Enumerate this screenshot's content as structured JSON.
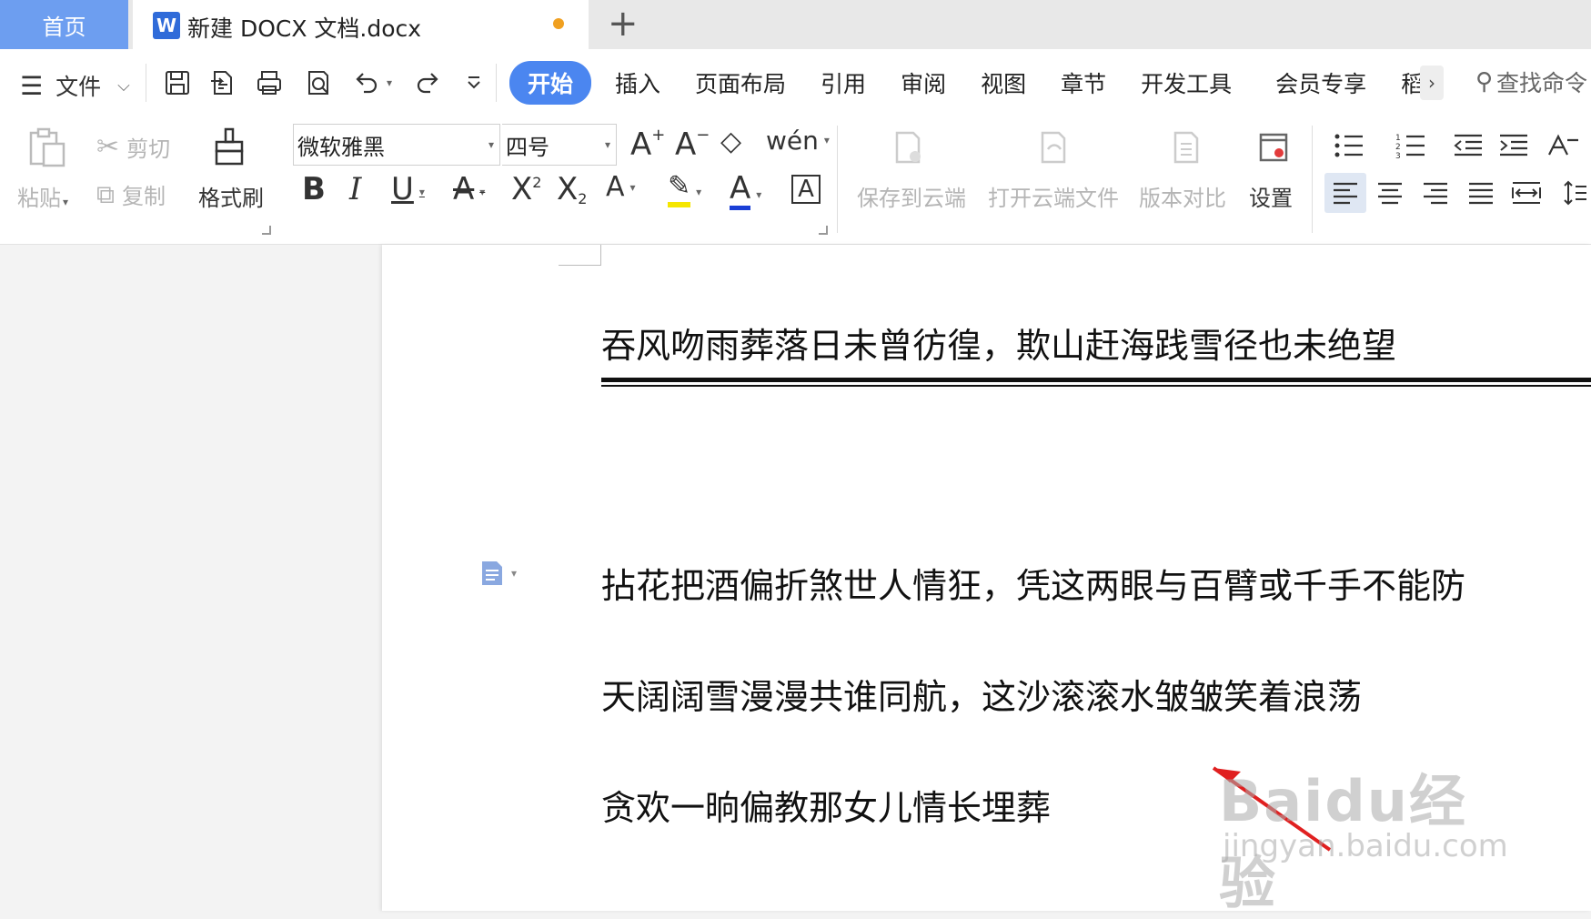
{
  "tabs": {
    "home_label": "首页",
    "doc_title": "新建 DOCX 文档.docx",
    "add_label": "+"
  },
  "menu": {
    "file_label": "文件",
    "tabs": [
      "开始",
      "插入",
      "页面布局",
      "引用",
      "审阅",
      "视图",
      "章节",
      "开发工具",
      "会员专享",
      "稻"
    ],
    "active_tab": "开始",
    "search_label": "查找命令"
  },
  "ribbon": {
    "paste": "粘贴",
    "cut": "剪切",
    "copy": "复制",
    "format_painter": "格式刷",
    "font_name": "微软雅黑",
    "font_size": "四号",
    "save_cloud": "保存到云端",
    "open_cloud": "打开云端文件",
    "version_compare": "版本对比",
    "settings": "设置"
  },
  "document": {
    "lines": [
      "吞风吻雨葬落日未曾彷徨，欺山赶海践雪径也未绝望",
      "拈花把酒偏折煞世人情狂，凭这两眼与百臂或千手不能防",
      "天阔阔雪漫漫共谁同航，这沙滚滚水皱皱笑着浪荡",
      "贪欢一晌偏教那女儿情长埋葬"
    ]
  },
  "watermark": {
    "brand": "Baidu经验",
    "url": "jingyan.baidu.com"
  },
  "colors": {
    "accent": "#4b86f0",
    "home_tab": "#6d9ef0",
    "unsaved_dot": "#f0a020",
    "highlight": "#f5e600",
    "font_color": "#1a3fd6",
    "arrow": "#e02020"
  }
}
